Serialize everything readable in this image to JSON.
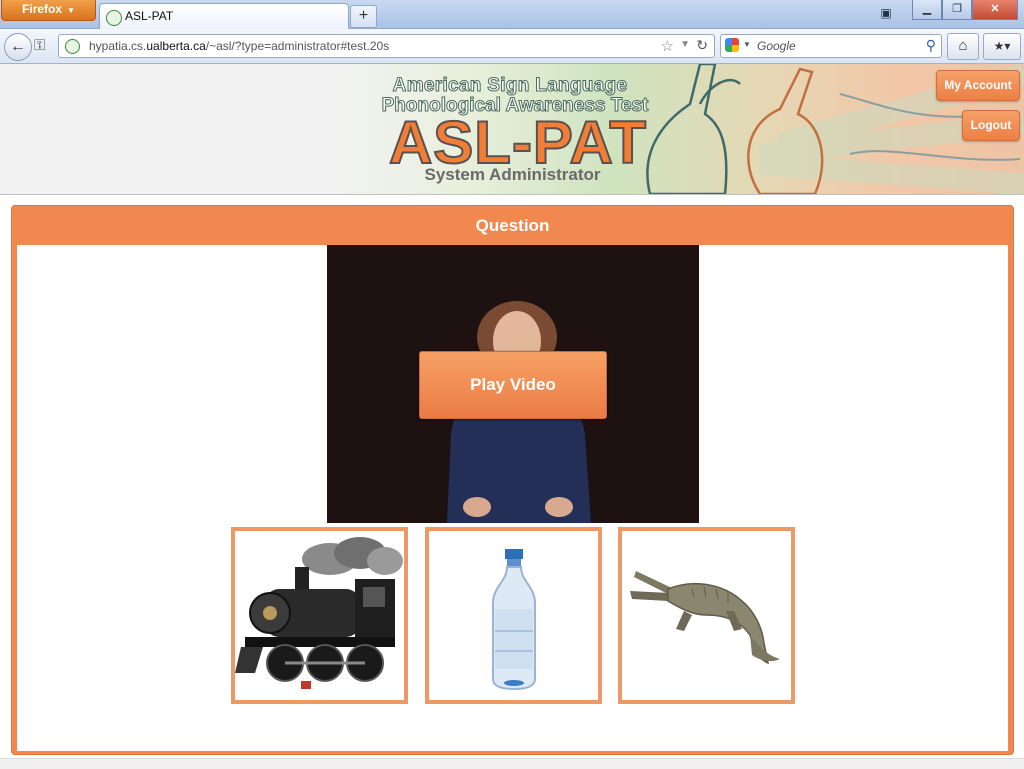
{
  "browser": {
    "app_button": "Firefox",
    "tab_title": "ASL-PAT",
    "new_tab": "+",
    "url_host_prefix": "hypatia.cs.",
    "url_host_domain": "ualberta.ca",
    "url_path": "/~asl/?type=administrator#test.20s",
    "search_placeholder": "Google"
  },
  "header": {
    "line1": "American Sign Language",
    "line2": "Phonological Awareness Test",
    "logo": "ASL-PAT",
    "role": "System Administrator",
    "my_account": "My Account",
    "logout": "Logout"
  },
  "question": {
    "title": "Question",
    "play_video": "Play Video",
    "choices": [
      "train",
      "bottle",
      "crocodile"
    ]
  },
  "colors": {
    "accent_orange": "#f0884f",
    "choice_border": "#ec9966",
    "video_background": "#1d1211"
  }
}
